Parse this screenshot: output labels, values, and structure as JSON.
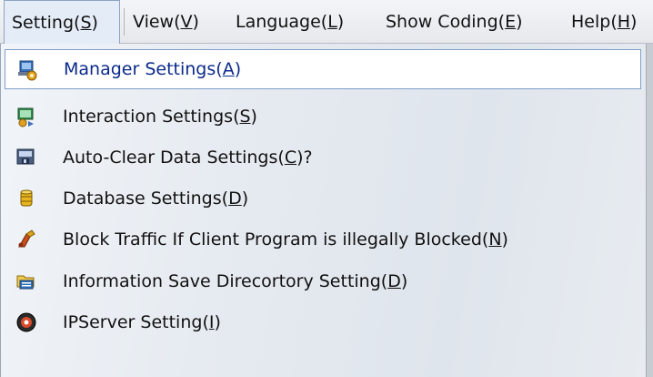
{
  "menubar": {
    "items": [
      {
        "label": "Setting",
        "mnemonic": "S"
      },
      {
        "label": "View",
        "mnemonic": "V"
      },
      {
        "label": "Language",
        "mnemonic": "L"
      },
      {
        "label": "Show Coding",
        "mnemonic": "E"
      },
      {
        "label": "Help",
        "mnemonic": "H"
      }
    ]
  },
  "menu": {
    "items": [
      {
        "label": "Manager Settings",
        "mnemonic": "A",
        "suffix": "",
        "icon": "manager-settings-icon"
      },
      {
        "label": "Interaction Settings",
        "mnemonic": "S",
        "suffix": "",
        "icon": "interaction-settings-icon"
      },
      {
        "label": "Auto-Clear Data Settings",
        "mnemonic": "C",
        "suffix": "?",
        "icon": "auto-clear-data-icon"
      },
      {
        "label": "Database Settings",
        "mnemonic": "D",
        "suffix": "",
        "icon": "database-icon"
      },
      {
        "label": "Block Traffic If Client Program is illegally Blocked",
        "mnemonic": "N",
        "suffix": "",
        "icon": "block-traffic-icon"
      },
      {
        "label": "Information Save Direcortory Setting",
        "mnemonic": "D",
        "suffix": "",
        "icon": "folder-icon"
      },
      {
        "label": "IPServer Setting",
        "mnemonic": "I",
        "suffix": "",
        "icon": "ip-server-icon"
      }
    ]
  },
  "colors": {
    "highlight_bg": "#ffffff",
    "highlight_border": "#7f9fc8",
    "highlight_text": "#0b2a8a"
  }
}
